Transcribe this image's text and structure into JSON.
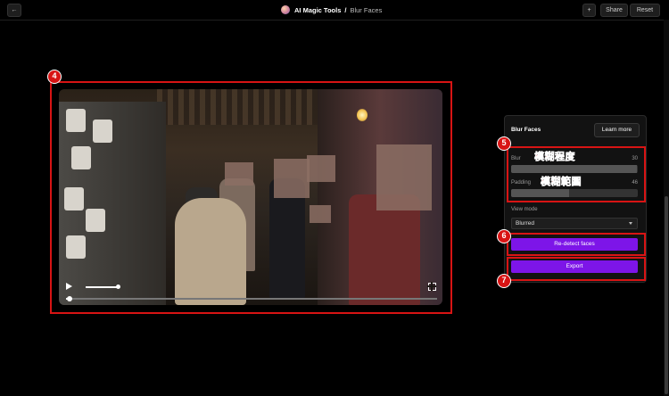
{
  "topbar": {
    "back_icon": "arrow-left-icon",
    "app_name": "AI Magic Tools",
    "separator": "/",
    "page_name": "Blur Faces",
    "plus_icon": "plus-icon",
    "share_label": "Share",
    "reset_label": "Reset"
  },
  "player": {
    "progress": 0.01,
    "volume": 0.95
  },
  "panel": {
    "title": "Blur Faces",
    "learn_more": "Learn more",
    "blur": {
      "label": "Blur",
      "value": "30",
      "fraction": 0.99
    },
    "padding": {
      "label": "Padding",
      "value": "46",
      "fraction": 0.46
    },
    "view_mode_label": "View mode",
    "view_mode_value": "Blurred",
    "redetect_label": "Re-detect faces",
    "export_label": "Export"
  },
  "annotations": {
    "badges": [
      "4",
      "5",
      "6",
      "7"
    ],
    "blur_caption": "模糊程度",
    "padding_caption": "模糊範圍"
  },
  "colors": {
    "accent": "#7d15e8",
    "annotation": "#d81414"
  }
}
